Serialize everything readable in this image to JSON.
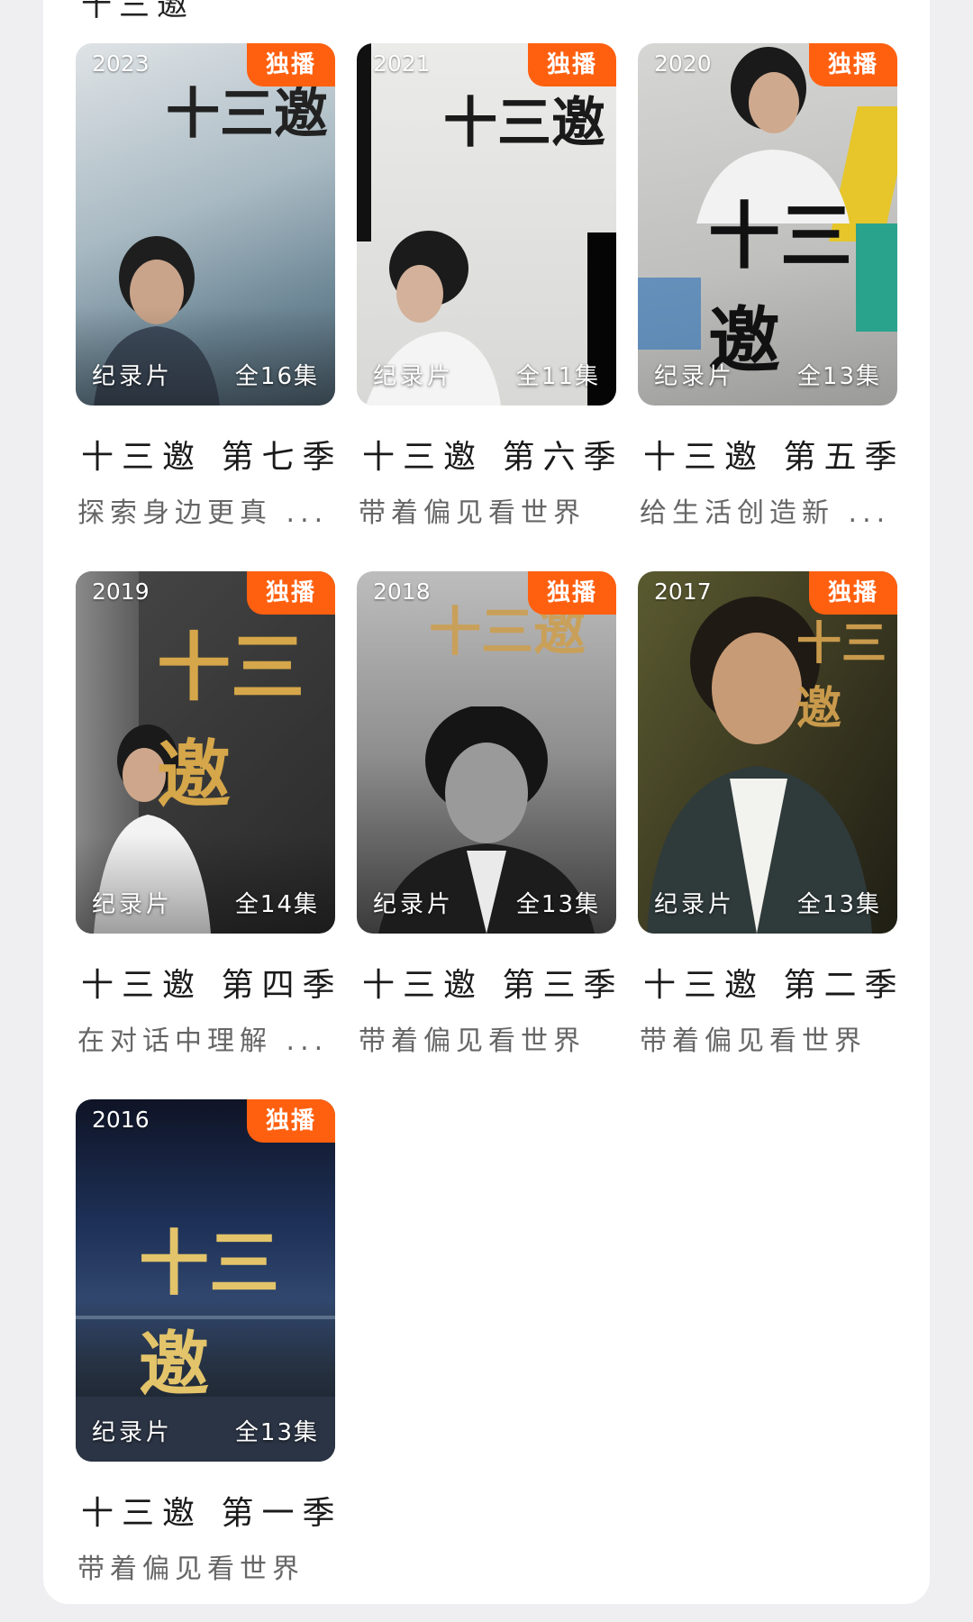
{
  "section": {
    "title": "十三邀"
  },
  "items": [
    {
      "year": "2023",
      "badge": "独播",
      "genre": "纪录片",
      "episodes": "全16集",
      "title": "十三邀 第七季",
      "subtitle": "探索身边更真 ..."
    },
    {
      "year": "2021",
      "badge": "独播",
      "genre": "纪录片",
      "episodes": "全11集",
      "title": "十三邀 第六季",
      "subtitle": "带着偏见看世界"
    },
    {
      "year": "2020",
      "badge": "独播",
      "genre": "纪录片",
      "episodes": "全13集",
      "title": "十三邀 第五季",
      "subtitle": "给生活创造新 ..."
    },
    {
      "year": "2019",
      "badge": "独播",
      "genre": "纪录片",
      "episodes": "全14集",
      "title": "十三邀 第四季",
      "subtitle": "在对话中理解 ..."
    },
    {
      "year": "2018",
      "badge": "独播",
      "genre": "纪录片",
      "episodes": "全13集",
      "title": "十三邀 第三季",
      "subtitle": "带着偏见看世界"
    },
    {
      "year": "2017",
      "badge": "独播",
      "genre": "纪录片",
      "episodes": "全13集",
      "title": "十三邀 第二季",
      "subtitle": "带着偏见看世界"
    },
    {
      "year": "2016",
      "badge": "独播",
      "genre": "纪录片",
      "episodes": "全13集",
      "title": "十三邀 第一季",
      "subtitle": "带着偏见看世界"
    }
  ],
  "poster_logo": "十三邀",
  "colors": {
    "badge": "#ff6010",
    "title": "#1a1a1a",
    "subtitle": "#666666"
  }
}
